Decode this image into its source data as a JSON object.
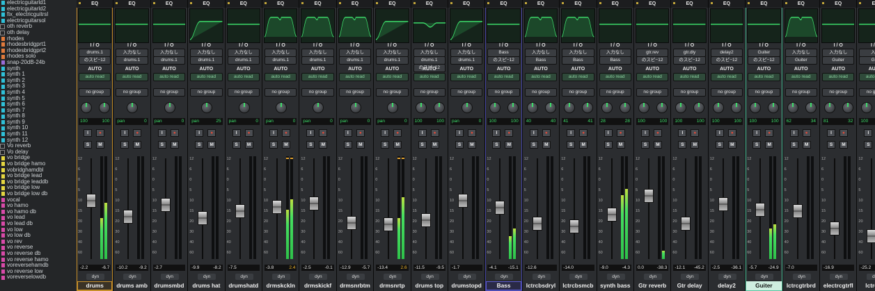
{
  "tracks": [
    {
      "name": "electricguitarld1",
      "color": "#2fc0d8",
      "chk": false
    },
    {
      "name": "electricguitarld2",
      "color": "#2fc0d8",
      "chk": false
    },
    {
      "name": "fix_electricguitrsl",
      "color": "#2fc0d8",
      "chk": false
    },
    {
      "name": "electricguitarsol",
      "color": "#2fc0d8",
      "chk": false
    },
    {
      "name": "oth reverb",
      "color": "",
      "chk": true
    },
    {
      "name": "oth delay",
      "color": "",
      "chk": true
    },
    {
      "name": "rhodes",
      "color": "#e07a3c",
      "chk": false
    },
    {
      "name": "rhodesbridgprt1",
      "color": "#e07a3c",
      "chk": false
    },
    {
      "name": "rhodesbridgprt2",
      "color": "#e07a3c",
      "chk": false
    },
    {
      "name": "rhodes solo",
      "color": "#e07a3c",
      "chk": false
    },
    {
      "name": "snap-20dB-24b",
      "color": "#9a6cd8",
      "chk": false
    },
    {
      "name": "synth",
      "color": "#2fc0d8",
      "chk": false
    },
    {
      "name": "synth 1",
      "color": "#2fc0d8",
      "chk": false
    },
    {
      "name": "synth 2",
      "color": "#2fc0d8",
      "chk": false
    },
    {
      "name": "synth 3",
      "color": "#2fc0d8",
      "chk": false
    },
    {
      "name": "synth 4",
      "color": "#2fc0d8",
      "chk": false
    },
    {
      "name": "synth 5",
      "color": "#2fc0d8",
      "chk": false
    },
    {
      "name": "synth 6",
      "color": "#2fc0d8",
      "chk": false
    },
    {
      "name": "synth 7",
      "color": "#2fc0d8",
      "chk": false
    },
    {
      "name": "synth 8",
      "color": "#2fc0d8",
      "chk": false
    },
    {
      "name": "synth 9",
      "color": "#2fc0d8",
      "chk": false
    },
    {
      "name": "synth 10",
      "color": "#2fc0d8",
      "chk": false
    },
    {
      "name": "synth 11",
      "color": "#2fc0d8",
      "chk": false
    },
    {
      "name": "synth 12",
      "color": "#2fc0d8",
      "chk": false
    },
    {
      "name": "Vo reverb",
      "color": "",
      "chk": true
    },
    {
      "name": "Vo delay",
      "color": "",
      "chk": true
    },
    {
      "name": "vo bridge",
      "color": "#e4d640",
      "chk": false
    },
    {
      "name": "vo bridge hamo",
      "color": "#e4d640",
      "chk": false
    },
    {
      "name": "vobridghamdbl",
      "color": "#e4d640",
      "chk": false
    },
    {
      "name": "vo bridge lead",
      "color": "#e4d640",
      "chk": false
    },
    {
      "name": "vo bridge leaddb",
      "color": "#e4d640",
      "chk": false
    },
    {
      "name": "vo bridge low",
      "color": "#e4d640",
      "chk": false
    },
    {
      "name": "vo bridge low db",
      "color": "#e4d640",
      "chk": false
    },
    {
      "name": "vocal",
      "color": "#d84aa8",
      "chk": false
    },
    {
      "name": "vo hamo",
      "color": "#d84aa8",
      "chk": false
    },
    {
      "name": "vo hamo db",
      "color": "#d84aa8",
      "chk": false
    },
    {
      "name": "vo lead",
      "color": "#d84aa8",
      "chk": false
    },
    {
      "name": "vo lead db",
      "color": "#d84aa8",
      "chk": false
    },
    {
      "name": "vo low",
      "color": "#d84aa8",
      "chk": false
    },
    {
      "name": "vo low db",
      "color": "#d84aa8",
      "chk": false
    },
    {
      "name": "vo rev",
      "color": "#d84aa8",
      "chk": false
    },
    {
      "name": "vo reverse",
      "color": "#d84aa8",
      "chk": false
    },
    {
      "name": "vo reverse db",
      "color": "#d84aa8",
      "chk": false
    },
    {
      "name": "vo reverse hamo",
      "color": "#d84aa8",
      "chk": false
    },
    {
      "name": "voreversehamdb",
      "color": "#d84aa8",
      "chk": false
    },
    {
      "name": "vo reverse low",
      "color": "#d84aa8",
      "chk": false
    },
    {
      "name": "voreverselowdb",
      "color": "#d84aa8",
      "chk": false
    }
  ],
  "mixer": {
    "eq_label": "EQ",
    "io_label": "I / O",
    "auto_label": "AUTO",
    "auto_mode": "auto read",
    "group": "no group",
    "solo": "S",
    "mute": "M",
    "input_btn": "I",
    "dyn": "dyn",
    "scale": [
      "12",
      "6",
      "0",
      "5",
      "10",
      "15",
      "20",
      "30",
      "40",
      "60"
    ],
    "strips": [
      {
        "name": "drums",
        "in": "",
        "out": "drums.1",
        "bus": "のスピ−12",
        "pan": [
          "100",
          "100"
        ],
        "dual": true,
        "vol": "-2.2",
        "peak": "-6.7",
        "hot": false,
        "fader": 0.6,
        "m1": 0.4,
        "m2": 0.55,
        "eq": "flat",
        "hl": "orange"
      },
      {
        "name": "drums amb",
        "in": "入力なし",
        "out": "drums.1",
        "bus": "",
        "pan": [
          "pan",
          "0"
        ],
        "dual": false,
        "vol": "-10.2",
        "peak": "-9.2",
        "hot": false,
        "fader": 0.42,
        "m1": 0.0,
        "m2": 0.0,
        "eq": "flat",
        "hl": ""
      },
      {
        "name": "drumsmbd",
        "in": "入力なし",
        "out": "drums.1",
        "bus": "",
        "pan": [
          "pan",
          "0"
        ],
        "dual": false,
        "vol": "-2.7",
        "peak": "",
        "hot": false,
        "fader": 0.55,
        "m1": 0.0,
        "m2": 0.0,
        "eq": "flat",
        "hl": ""
      },
      {
        "name": "drums hat",
        "in": "入力なし",
        "out": "drums.1",
        "bus": "",
        "pan": [
          "pan",
          "25"
        ],
        "dual": false,
        "vol": "-9.9",
        "peak": "-8.2",
        "hot": false,
        "fader": 0.4,
        "m1": 0.0,
        "m2": 0.0,
        "eq": "hp",
        "hl": ""
      },
      {
        "name": "drumshatd",
        "in": "入力なし",
        "out": "drums.1",
        "bus": "",
        "pan": [
          "pan",
          "0"
        ],
        "dual": false,
        "vol": "-7.5",
        "peak": "",
        "hot": false,
        "fader": 0.48,
        "m1": 0.0,
        "m2": 0.0,
        "eq": "flat",
        "hl": ""
      },
      {
        "name": "drmskckln",
        "in": "入力なし",
        "out": "drums.1",
        "bus": "",
        "pan": [
          "pan",
          "0"
        ],
        "dual": false,
        "vol": "-3.8",
        "peak": "2.4",
        "hot": true,
        "fader": 0.53,
        "m1": 0.48,
        "m2": 0.58,
        "eq": "bump",
        "hl": ""
      },
      {
        "name": "drmskickf",
        "in": "入力なし",
        "out": "drums.1",
        "bus": "",
        "pan": [
          "pan",
          "0"
        ],
        "dual": false,
        "vol": "-2.5",
        "peak": "-0.1",
        "hot": false,
        "fader": 0.57,
        "m1": 0.0,
        "m2": 0.0,
        "eq": "bump",
        "hl": ""
      },
      {
        "name": "drmsnrbtm",
        "in": "入力なし",
        "out": "drums.1",
        "bus": "",
        "pan": [
          "pan",
          "0"
        ],
        "dual": false,
        "vol": "-12.9",
        "peak": "-5.7",
        "hot": false,
        "fader": 0.35,
        "m1": 0.0,
        "m2": 0.0,
        "eq": "bump",
        "hl": ""
      },
      {
        "name": "drmsnrtp",
        "in": "入力なし",
        "out": "drums.1",
        "bus": "",
        "pan": [
          "pan",
          "0"
        ],
        "dual": false,
        "vol": "-13.4",
        "peak": "2.6",
        "hot": true,
        "fader": 0.33,
        "m1": 0.4,
        "m2": 0.6,
        "eq": "hp",
        "hl": ""
      },
      {
        "name": "drums top",
        "in": "入力なし",
        "out": "drums.1",
        "bus": "のスピ−12",
        "pan": [
          "100",
          "100"
        ],
        "dual": true,
        "vol": "-11.5",
        "peak": "-9.5",
        "hot": false,
        "fader": 0.38,
        "m1": 0.0,
        "m2": 0.0,
        "eq": "dip",
        "hl": ""
      },
      {
        "name": "drumstopd",
        "in": "入力なし",
        "out": "drums.1",
        "bus": "",
        "pan": [
          "pan",
          "0"
        ],
        "dual": false,
        "vol": "-1.7",
        "peak": "",
        "hot": false,
        "fader": 0.6,
        "m1": 0.0,
        "m2": 0.0,
        "eq": "hp",
        "hl": ""
      },
      {
        "name": "Bass",
        "in": "Bass",
        "out": "",
        "bus": "のスピ−12",
        "pan": [
          "100",
          "100"
        ],
        "dual": true,
        "vol": "-4.1",
        "peak": "-15.1",
        "hot": false,
        "fader": 0.52,
        "m1": 0.22,
        "m2": 0.3,
        "eq": "flat",
        "hl": "blue"
      },
      {
        "name": "lctrcbsdryl",
        "in": "入力なし",
        "out": "Bass",
        "bus": "",
        "pan": [
          "40",
          "40"
        ],
        "dual": true,
        "vol": "-12.6",
        "peak": "",
        "hot": false,
        "fader": 0.34,
        "m1": 0.0,
        "m2": 0.0,
        "eq": "bump",
        "hl": ""
      },
      {
        "name": "lctrcbsmcb",
        "in": "入力なし",
        "out": "Bass",
        "bus": "",
        "pan": [
          "41",
          "41"
        ],
        "dual": true,
        "vol": "-14.0",
        "peak": "",
        "hot": false,
        "fader": 0.31,
        "m1": 0.0,
        "m2": 0.0,
        "eq": "bump",
        "hl": ""
      },
      {
        "name": "synth bass",
        "in": "入力なし",
        "out": "Bass",
        "bus": "",
        "pan": [
          "28",
          "28"
        ],
        "dual": true,
        "vol": "-9.0",
        "peak": "-4.3",
        "hot": false,
        "fader": 0.44,
        "m1": 0.62,
        "m2": 0.68,
        "eq": "flat",
        "hl": ""
      },
      {
        "name": "Gtr reverb",
        "in": "gtr.rev",
        "out": "",
        "bus": "のスピ−12",
        "pan": [
          "100",
          "100"
        ],
        "dual": true,
        "vol": "0.0",
        "peak": "-38.3",
        "hot": false,
        "fader": 0.65,
        "m1": 0.0,
        "m2": 0.08,
        "eq": "flat",
        "hl": ""
      },
      {
        "name": "Gtr delay",
        "in": "gtr.dly",
        "out": "",
        "bus": "のスピ−12",
        "pan": [
          "100",
          "100"
        ],
        "dual": true,
        "vol": "-12.1",
        "peak": "-45.2",
        "hot": false,
        "fader": 0.34,
        "m1": 0.0,
        "m2": 0.0,
        "eq": "flat",
        "hl": ""
      },
      {
        "name": "delay2",
        "in": "delay2",
        "out": "",
        "bus": "のスピ−12",
        "pan": [
          "100",
          "100"
        ],
        "dual": true,
        "vol": "-2.5",
        "peak": "-36.1",
        "hot": false,
        "fader": 0.56,
        "m1": 0.0,
        "m2": 0.0,
        "eq": "flat",
        "hl": ""
      },
      {
        "name": "Guiter",
        "in": "Guiter",
        "out": "",
        "bus": "のスピ−12",
        "pan": [
          "100",
          "100"
        ],
        "dual": true,
        "vol": "-5.7",
        "peak": "-24.9",
        "hot": false,
        "fader": 0.5,
        "m1": 0.3,
        "m2": 0.34,
        "eq": "flat",
        "hl": "green"
      },
      {
        "name": "lctrcgtrbrd",
        "in": "入力なし",
        "out": "Guiter",
        "bus": "",
        "pan": [
          "62",
          "34"
        ],
        "dual": true,
        "vol": "-7.0",
        "peak": "",
        "hot": false,
        "fader": 0.48,
        "m1": 0.0,
        "m2": 0.0,
        "eq": "bump",
        "hl": ""
      },
      {
        "name": "electrcgtrfl",
        "in": "入力なし",
        "out": "Guiter",
        "bus": "",
        "pan": [
          "81",
          "32"
        ],
        "dual": true,
        "vol": "-16.9",
        "peak": "",
        "hot": false,
        "fader": 0.28,
        "m1": 0.0,
        "m2": 0.0,
        "eq": "flat",
        "hl": ""
      },
      {
        "name": "lctrcgtr",
        "in": "入力",
        "out": "Guit",
        "bus": "",
        "pan": [
          "100",
          ""
        ],
        "dual": true,
        "vol": "-25.2",
        "peak": "",
        "hot": false,
        "fader": 0.2,
        "m1": 0.0,
        "m2": 0.0,
        "eq": "flat",
        "hl": ""
      }
    ]
  }
}
